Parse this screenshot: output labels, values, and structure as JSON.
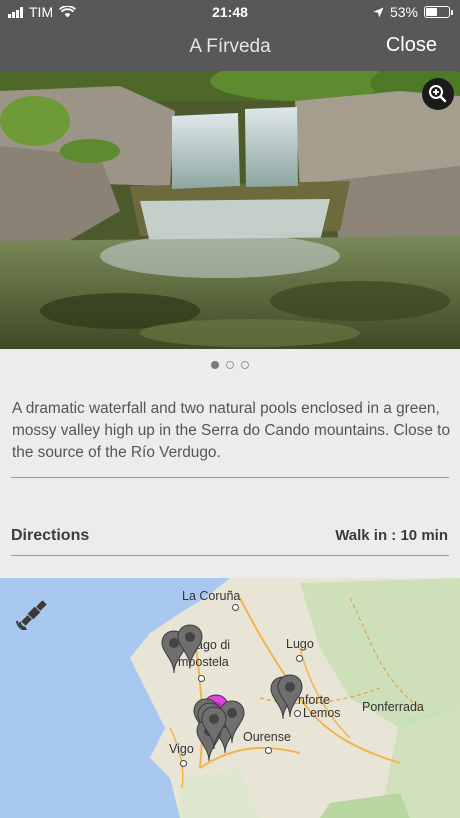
{
  "status": {
    "carrier": "TIM",
    "time": "21:48",
    "battery": "53%",
    "battery_level": 0.53
  },
  "nav": {
    "title": "A Fírveda",
    "close_label": "Close"
  },
  "gallery": {
    "page_count": 3,
    "active_index": 0
  },
  "description": "A dramatic waterfall and two natural pools enclosed in a green, mossy valley high up in the Serra do Cando mountains. Close to the source of the Río Verdugo.",
  "directions": {
    "label": "Directions",
    "walk": "Walk in : 10 min"
  },
  "map": {
    "labels": {
      "coruna": "La Coruña",
      "santiago_1": "ago di",
      "santiago_2": "mpostela",
      "lugo": "Lugo",
      "monforte_1": "nforte",
      "monforte_2": "Lemos",
      "ponferrada": "Ponferrada",
      "ourense": "Ourense",
      "vigo": "Vigo"
    },
    "colors": {
      "sea": "#a8c8f0",
      "land": "#e9e5d6",
      "green": "#c6dfb3",
      "pin": "#6f6f6f",
      "selected_pin": "#e040e0"
    }
  }
}
